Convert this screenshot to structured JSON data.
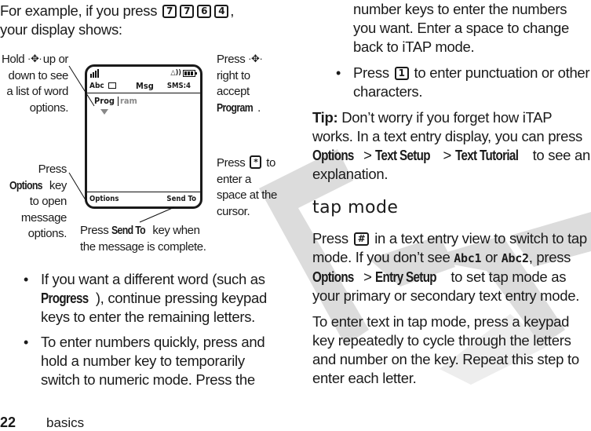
{
  "intro": {
    "text_before": "For example, if you press",
    "keys": [
      "7",
      "7",
      "6",
      "4"
    ],
    "text_after": ",",
    "line2": "your display shows:"
  },
  "phone_display": {
    "status_icons": [
      "signal-strength-icon",
      "alert-icon",
      "battery-icon"
    ],
    "mode_label": "Abc",
    "title": "Msg",
    "counter": "SMS:4",
    "typed_text": "Prog",
    "suggestion_completion": "ram",
    "left_softkey": "Options",
    "right_softkey": "Send To"
  },
  "callouts": {
    "hold_nav": {
      "pre": "Hold",
      "post": "up or down to see a list of word options."
    },
    "press_right": {
      "pre": "Press",
      "mid": "right to accept",
      "bold": "Program",
      "post": "."
    },
    "press_options": {
      "pre": "Press",
      "bold": "Options",
      "post": "key to open message options."
    },
    "press_star": {
      "pre": "Press",
      "key": "*",
      "post": "to enter a space at the cursor."
    },
    "press_send": {
      "pre": "Press",
      "bold": "Send To",
      "post1": "key when",
      "post2": "the message is complete."
    }
  },
  "left_bullets": [
    {
      "pre": "If you want a different word (such as",
      "bold": "Progress",
      "post": "), continue pressing keypad keys to enter the remaining letters."
    },
    {
      "text": "To enter numbers quickly, press and hold a number key to temporarily switch to numeric mode. Press the"
    }
  ],
  "right_column": {
    "continuation": "number keys to enter the numbers you want. Enter a space to change back to iTAP mode.",
    "bullet": {
      "pre": "Press",
      "key": "1",
      "post": "to enter punctuation or other characters."
    },
    "tip": {
      "label": "Tip:",
      "text1": "Don’t worry if you forget how iTAP works. In a text entry display, you can press",
      "path": [
        "Options",
        "Text Setup",
        "Text Tutorial"
      ],
      "text2": "to see an explanation."
    },
    "heading": "tap mode",
    "para1": {
      "pre": "Press",
      "key": "#",
      "mid": "in a text entry view to switch to tap mode. If you don’t see",
      "mode1": "Abc1",
      "or": "or",
      "mode2": "Abc2",
      "mid2": ", press",
      "path": [
        "Options",
        "Entry Setup"
      ],
      "post": "to set tap mode as your primary or secondary text entry mode."
    },
    "para2": "To enter text in tap mode, press a keypad key repeatedly to cycle through the letters and number on the key. Repeat this step to enter each letter."
  },
  "footer": {
    "page_number": "22",
    "section": "basics"
  },
  "watermark": {
    "text": "DRAFT",
    "color": "#d9d9d9"
  }
}
